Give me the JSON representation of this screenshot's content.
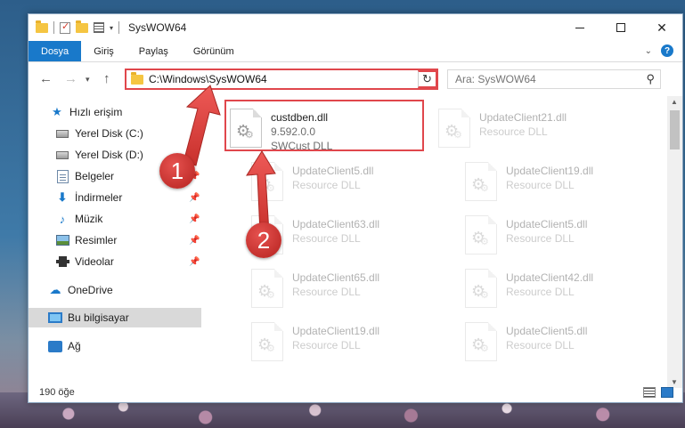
{
  "window": {
    "title": "SysWOW64"
  },
  "ribbon": {
    "tabs": [
      "Dosya",
      "Giriş",
      "Paylaş",
      "Görünüm"
    ]
  },
  "address": {
    "path": "C:\\Windows\\SysWOW64"
  },
  "search": {
    "placeholder": "Ara: SysWOW64"
  },
  "sidebar": {
    "items": [
      {
        "label": "Hızlı erişim",
        "icon": "star-icon"
      },
      {
        "label": "Yerel Disk (C:)",
        "icon": "disk-icon"
      },
      {
        "label": "Yerel Disk (D:)",
        "icon": "disk-icon"
      },
      {
        "label": "Belgeler",
        "icon": "documents-icon"
      },
      {
        "label": "İndirmeler",
        "icon": "download-icon"
      },
      {
        "label": "Müzik",
        "icon": "music-icon"
      },
      {
        "label": "Resimler",
        "icon": "pictures-icon"
      },
      {
        "label": "Videolar",
        "icon": "videos-icon"
      },
      {
        "label": "OneDrive",
        "icon": "cloud-icon"
      },
      {
        "label": "Bu bilgisayar",
        "icon": "computer-icon"
      },
      {
        "label": "Ağ",
        "icon": "network-icon"
      }
    ]
  },
  "files": [
    {
      "name": "custdben.dll",
      "line2": "9.592.0.0",
      "line3": "SWCust DLL"
    },
    {
      "name": "UpdateClient21.dll",
      "line2": "Resource DLL"
    },
    {
      "name": "UpdateClient5.dll",
      "line2": "Resource DLL"
    },
    {
      "name": "UpdateClient19.dll",
      "line2": "Resource DLL"
    },
    {
      "name": "UpdateClient63.dll",
      "line2": "Resource DLL"
    },
    {
      "name": "UpdateClient5.dll",
      "line2": "Resource DLL"
    },
    {
      "name": "UpdateClient65.dll",
      "line2": "Resource DLL"
    },
    {
      "name": "UpdateClient42.dll",
      "line2": "Resource DLL"
    },
    {
      "name": "UpdateClient19.dll",
      "line2": "Resource DLL"
    },
    {
      "name": "UpdateClient5.dll",
      "line2": "Resource DLL"
    }
  ],
  "status": {
    "count": "190 öğe"
  },
  "annotations": {
    "step1": "1",
    "step2": "2",
    "color": "#e0474c"
  }
}
